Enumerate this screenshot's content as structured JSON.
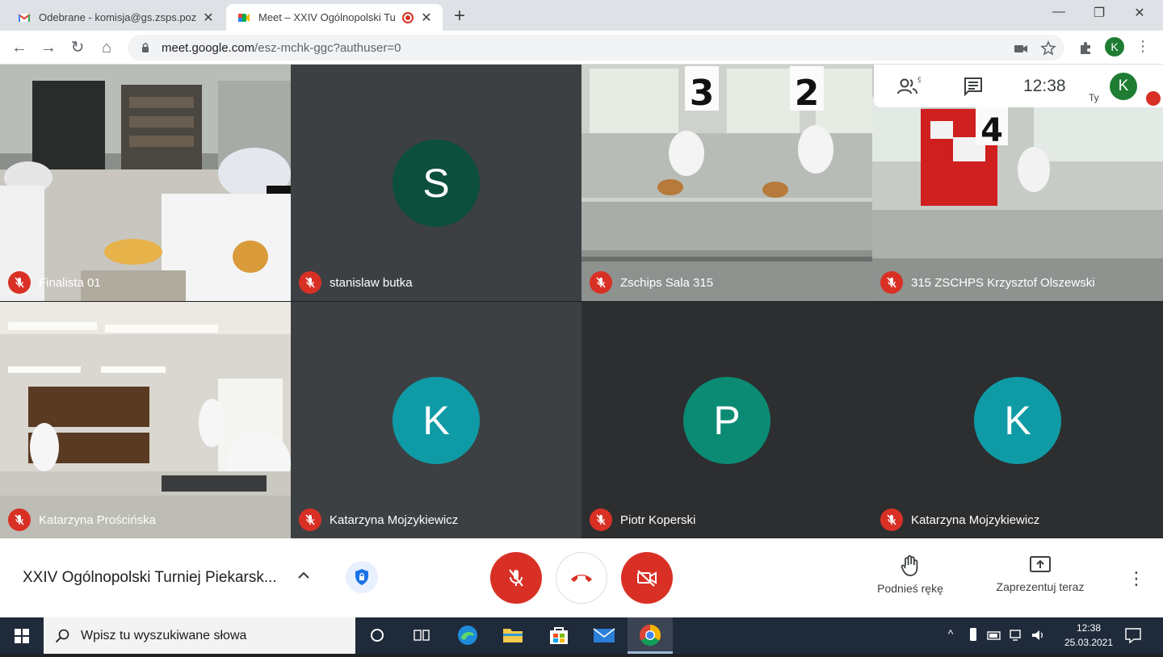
{
  "browser": {
    "tabs": [
      {
        "title": "Odebrane - komisja@gs.zsps.poz",
        "icon": "gmail-icon"
      },
      {
        "title": "Meet – XXIV Ogólnopolski Tu",
        "icon": "meet-icon",
        "recording": true
      }
    ],
    "url_host": "meet.google.com",
    "url_path": "/esz-mchk-ggc?authuser=0",
    "profile_initial": "K"
  },
  "meet": {
    "participant_count_badge": "9",
    "time": "12:38",
    "self_label": "Ty",
    "self_initial": "K",
    "participants": [
      {
        "name": "Finalista 01",
        "type": "video",
        "muted": true
      },
      {
        "name": "stanislaw butka",
        "type": "avatar",
        "initial": "S",
        "color": "#0b4f3c",
        "muted": true
      },
      {
        "name": "Zschips Sala 315",
        "type": "video",
        "muted": true
      },
      {
        "name": "315 ZSCHPS Krzysztof Olszewski",
        "type": "video",
        "muted": true
      },
      {
        "name": "Katarzyna Prościńska",
        "type": "video",
        "muted": true
      },
      {
        "name": "Katarzyna Mojzykiewicz",
        "type": "avatar",
        "initial": "K",
        "color": "#0f9ba6",
        "muted": true
      },
      {
        "name": "Piotr Koperski",
        "type": "avatar",
        "initial": "P",
        "color": "#0b8b74",
        "muted": true
      },
      {
        "name": "Katarzyna Mojzykiewicz",
        "type": "avatar",
        "initial": "K",
        "color": "#0f9ba6",
        "muted": true
      }
    ],
    "meeting_title": "XXIV Ogólnopolski Turniej Piekarsk...",
    "raise_hand_label": "Podnieś rękę",
    "present_label": "Zaprezentuj teraz"
  },
  "taskbar": {
    "search_placeholder": "Wpisz tu wyszukiwane słowa",
    "time": "12:38",
    "date": "25.03.2021"
  }
}
